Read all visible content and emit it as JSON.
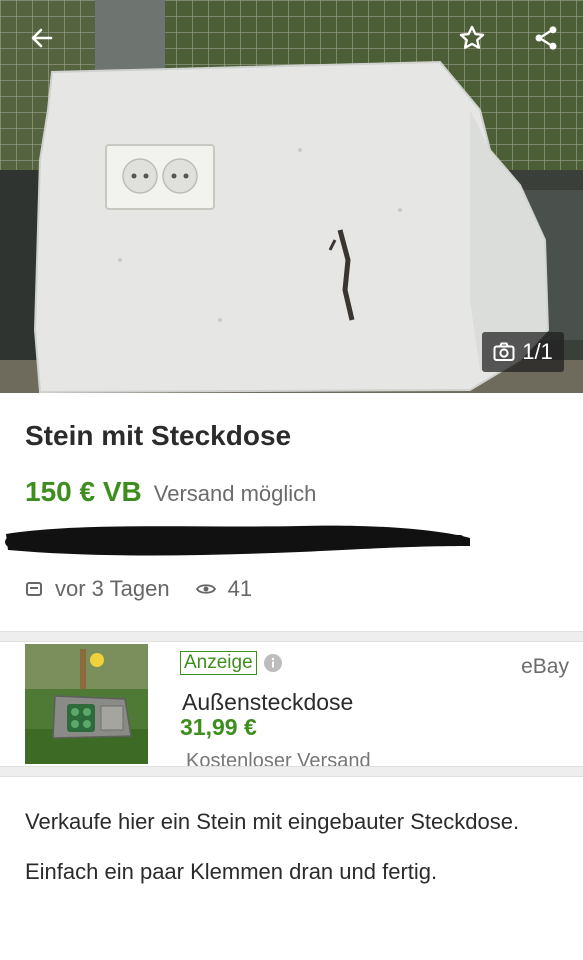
{
  "gallery": {
    "counter": "1/1"
  },
  "icons": {
    "back": "arrow-left-icon",
    "favorite": "star-icon",
    "share": "share-icon",
    "camera": "camera-icon",
    "date": "calendar-icon",
    "views": "eye-icon",
    "info": "info-icon"
  },
  "listing": {
    "title": "Stein mit Steckdose",
    "price": "150 € VB",
    "shipping": "Versand möglich",
    "posted": "vor 3 Tagen",
    "views": "41"
  },
  "ad": {
    "badge": "Anzeige",
    "source": "eBay",
    "title": "Außensteckdose",
    "price": "31,99 €",
    "shipping": "Kostenloser Versand"
  },
  "description": {
    "paragraphs": [
      "Verkaufe hier ein Stein mit eingebauter Steckdose.",
      "Einfach ein paar Klemmen dran und fertig."
    ]
  },
  "colors": {
    "accent_green": "#3e8e1e",
    "text_dark": "#2b2b2b",
    "text_muted": "#6b6b6b",
    "divider": "#eeeeee"
  }
}
